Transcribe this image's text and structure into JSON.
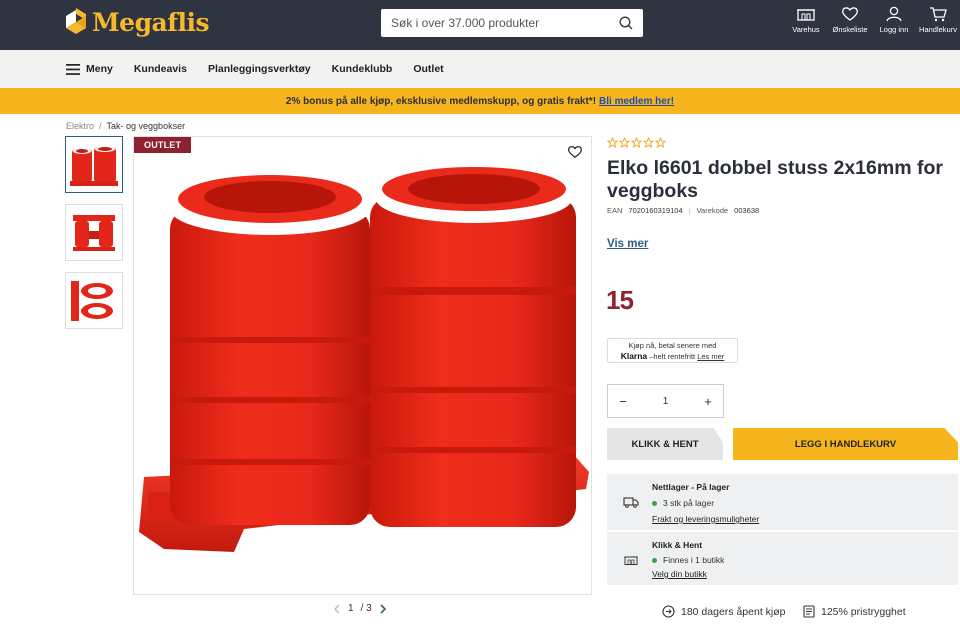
{
  "header": {
    "logo_text": "Megaflis",
    "search_placeholder": "Søk i over 37.000 produkter",
    "actions": [
      {
        "label": "Varehus",
        "icon": "store-icon"
      },
      {
        "label": "Ønskeliste",
        "icon": "heart-icon"
      },
      {
        "label": "Logg inn",
        "icon": "user-icon"
      },
      {
        "label": "Handlekurv",
        "icon": "cart-icon"
      }
    ]
  },
  "nav": {
    "menu_label": "Meny",
    "items": [
      "Kundeavis",
      "Planleggingsverktøy",
      "Kundeklubb",
      "Outlet"
    ]
  },
  "promo": {
    "text": "2% bonus på alle kjøp, eksklusive medlemskupp, og gratis frakt*!",
    "link": "Bli medlem her!"
  },
  "breadcrumb": {
    "items": [
      "Elektro",
      "Tak- og veggbokser"
    ],
    "separator": "/"
  },
  "gallery": {
    "badge": "OUTLET",
    "current_page": "1",
    "total_pages": "/ 3"
  },
  "product": {
    "title": "Elko l6601 dobbel stuss 2x16mm for veggboks",
    "ean_label": "EAN",
    "ean": "7020160319104",
    "varekode_label": "Varekode",
    "varekode": "003638",
    "show_more": "Vis mer",
    "price": "15",
    "rating_stars": 0,
    "rating_max": 5
  },
  "klarna": {
    "line1": "Kjøp nå, betal senere med",
    "brand": "Klarna",
    "line2": "–helt rentefritt",
    "link": "Les mer"
  },
  "purchase": {
    "quantity": "1",
    "minus": "−",
    "plus": "+",
    "click_collect": "KLIKK & HENT",
    "add_to_cart": "LEGG I HANDLEKURV"
  },
  "stock": {
    "online": {
      "title": "Nettlager - På lager",
      "status": "3 stk på lager",
      "link": "Frakt og leveringsmuligheter"
    },
    "store": {
      "title": "Klikk & Hent",
      "status": "Finnes i 1 butikk",
      "link": "Velg din butikk"
    }
  },
  "guarantees": [
    "180 dagers åpent kjøp",
    "125% pristrygghet"
  ],
  "colors": {
    "header_bg": "#2f3540",
    "logo_yellow": "#f5b82e",
    "promo_yellow": "#f6b51c",
    "outlet_red": "#8e2230",
    "link_blue": "#2b5e80",
    "stock_green": "#3aa24b"
  }
}
